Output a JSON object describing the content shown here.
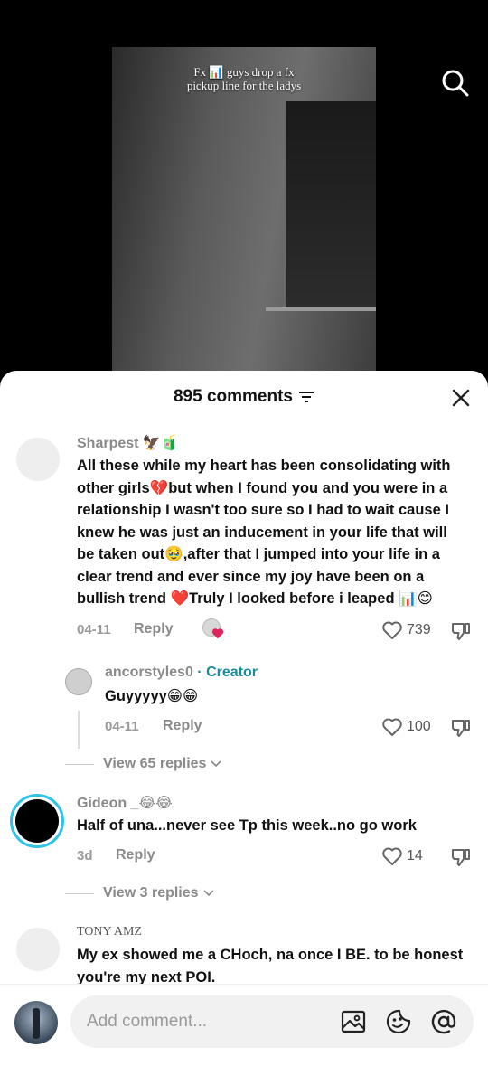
{
  "video": {
    "caption_line1": "Fx 📊 guys drop a fx",
    "caption_line2": "pickup line for the ladys"
  },
  "header": {
    "comment_count": "895 comments"
  },
  "comments": [
    {
      "username": "Sharpest 🦅🧃",
      "text": "All these while my heart has been consolidating with other girls💔but when I found you and you were in a relationship I wasn't too sure so I had to wait cause I knew he was just an inducement in your life that will be taken out🥹,after that I jumped into your life in a clear trend and ever since my joy have been on a bullish trend ❤️Truly I looked before i leaped 📊😊",
      "date": "04-11",
      "reply_label": "Reply",
      "likes": "739"
    },
    {
      "username": "ancorstyles0",
      "creator_label": "· Creator",
      "text": "Guyyyyy😁😁",
      "date": "04-11",
      "reply_label": "Reply",
      "likes": "100"
    },
    {
      "username": "Gideon _😂😂",
      "text": "Half of una...never see Tp this week..no go work",
      "date": "3d",
      "reply_label": "Reply",
      "likes": "14"
    },
    {
      "username": "TONY AMZ",
      "text": "My ex showed me a CHoch, na once I BE. to be honest you're my next POI."
    }
  ],
  "view_replies": [
    {
      "label": "View 65 replies"
    },
    {
      "label": "View 3 replies"
    }
  ],
  "composer": {
    "placeholder": "Add comment..."
  },
  "colors": {
    "creator": "#1a8c9a",
    "story_ring": "#2ec4e8",
    "heart_red": "#e0245e"
  }
}
